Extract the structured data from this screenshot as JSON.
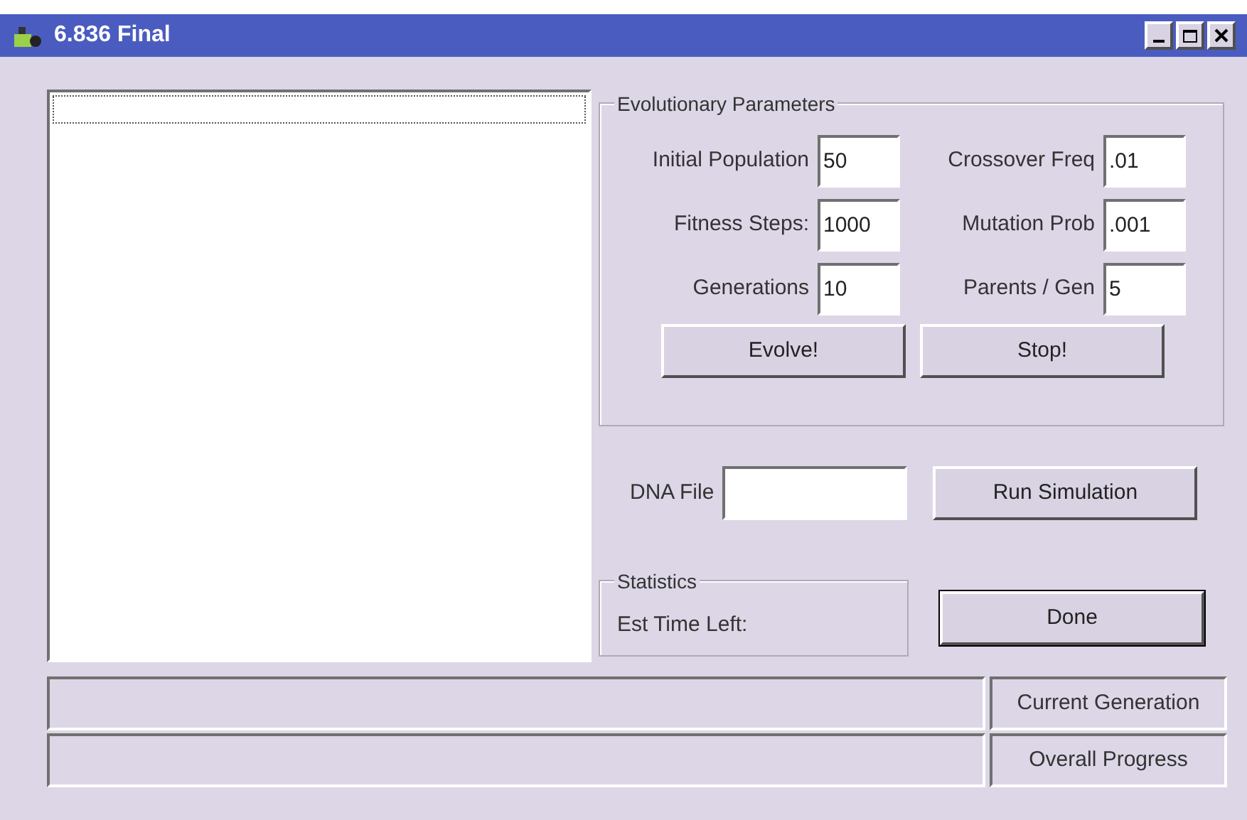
{
  "window": {
    "title": "6.836 Final"
  },
  "evolutionary_parameters": {
    "title": "Evolutionary Parameters",
    "fields": [
      {
        "label": "Initial Population",
        "value": "50"
      },
      {
        "label": "Crossover Freq",
        "value": ".01"
      },
      {
        "label": "Fitness Steps:",
        "value": "1000"
      },
      {
        "label": "Mutation Prob",
        "value": ".001"
      },
      {
        "label": "Generations",
        "value": "10"
      },
      {
        "label": "Parents / Gen",
        "value": "5"
      }
    ],
    "buttons": [
      "Evolve!",
      "Stop!"
    ]
  },
  "dna_file": {
    "label": "DNA File",
    "button": "Run Simulation"
  },
  "statistics": {
    "title": "Statistics",
    "text": "Est Time Left:"
  },
  "done_button": "Done",
  "progress": [
    {
      "label": "Current Generation",
      "level": 0
    },
    {
      "label": "Overall Progress",
      "level": 0
    }
  ]
}
